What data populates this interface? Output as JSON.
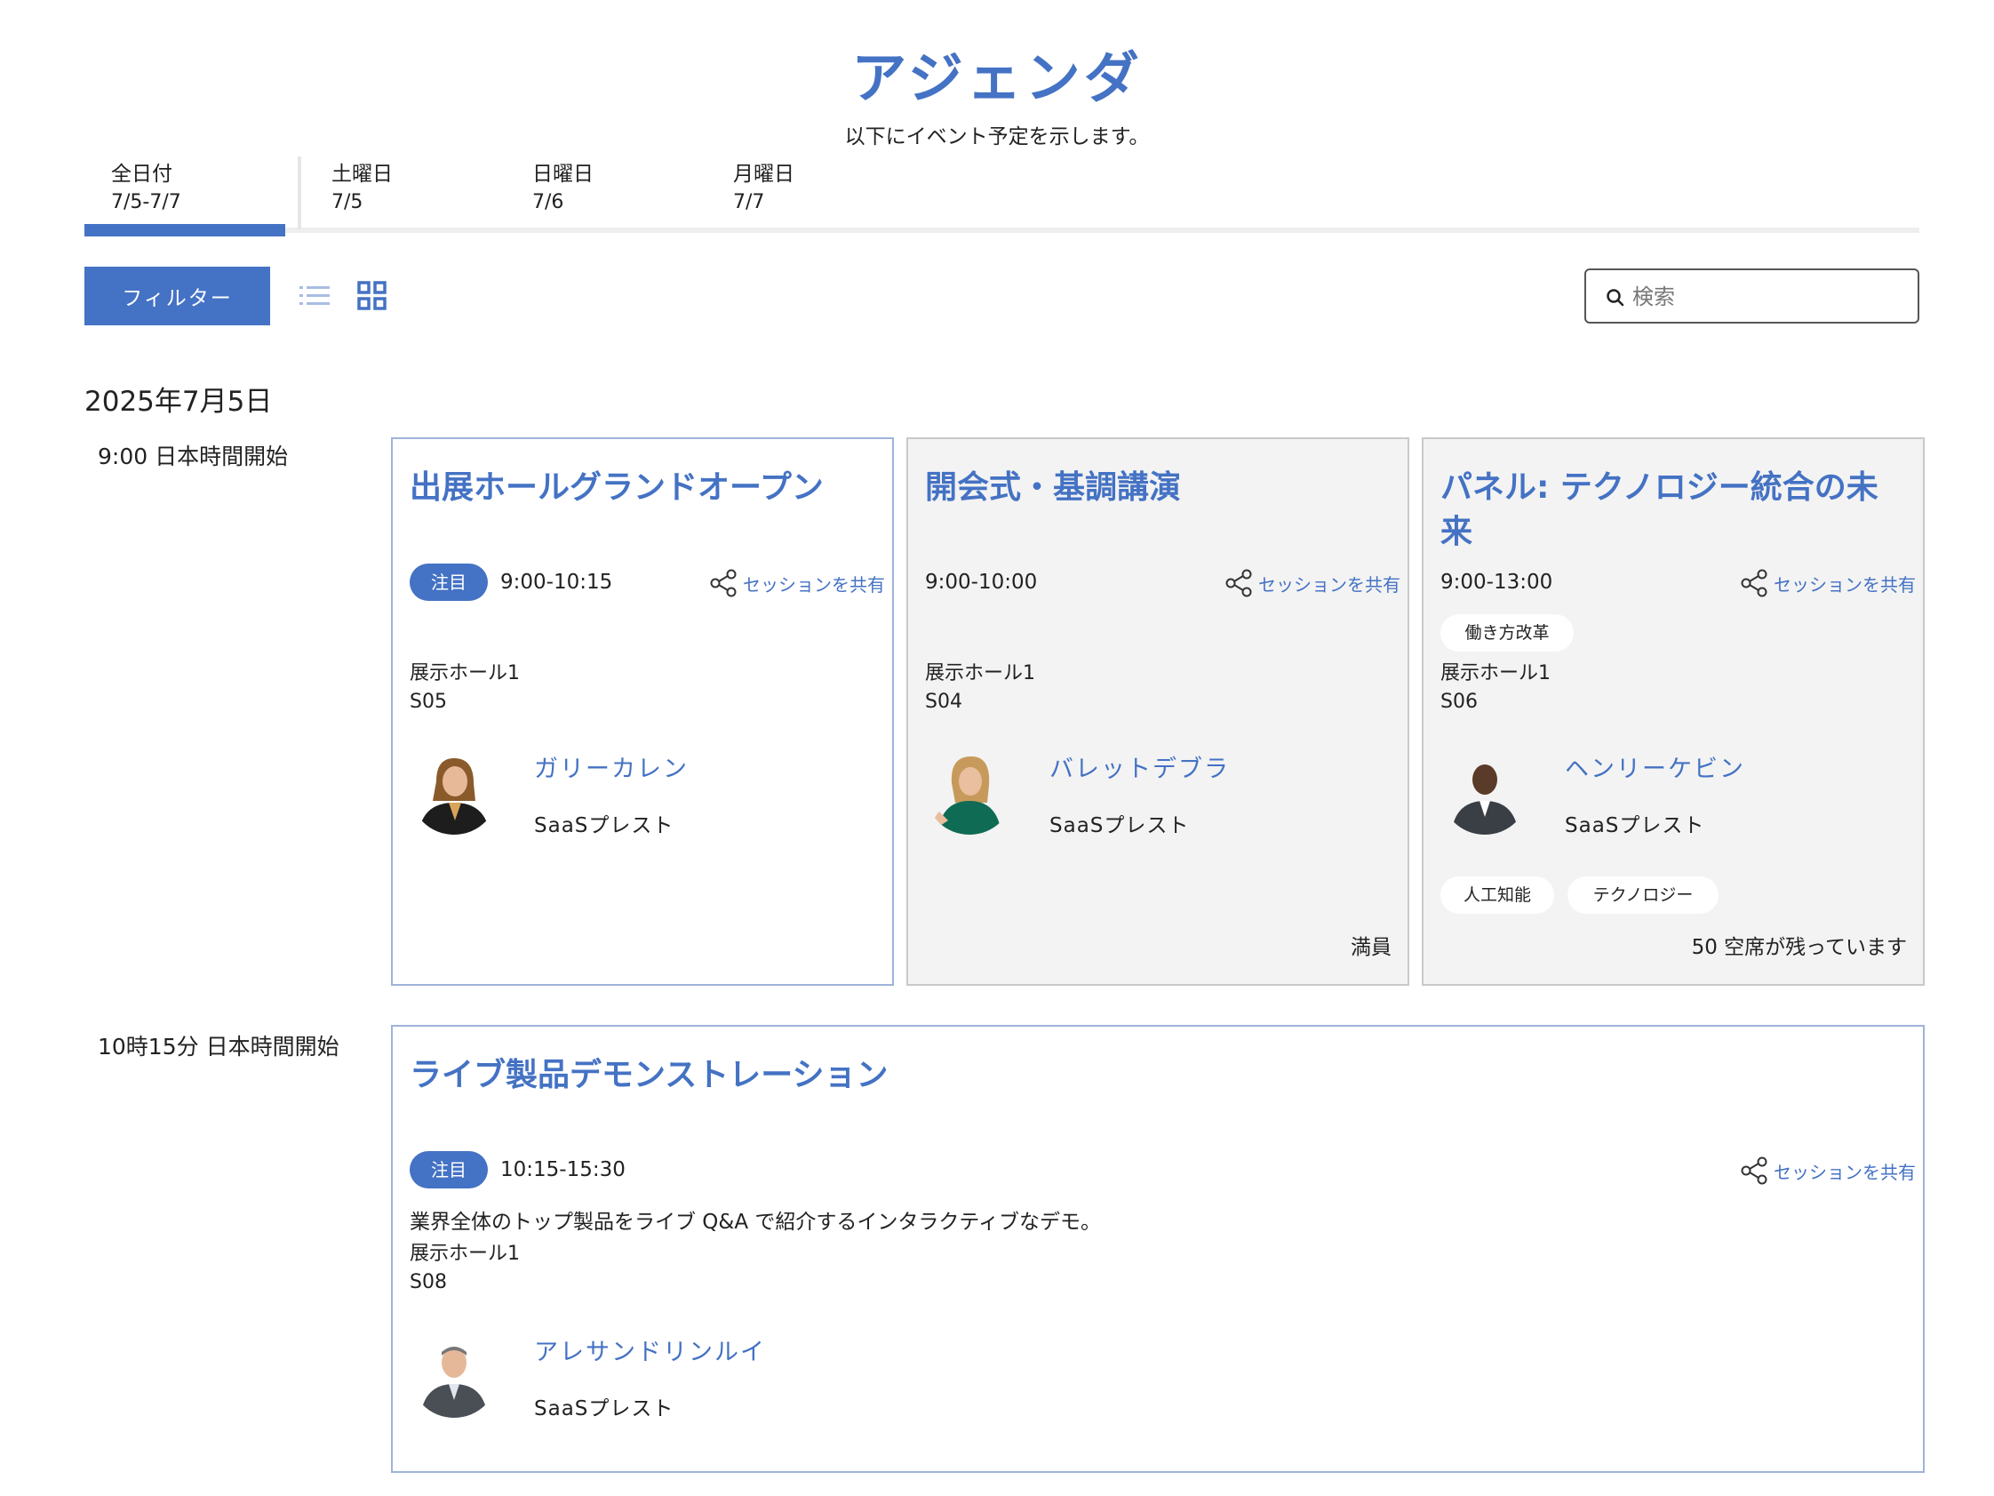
{
  "header": {
    "title": "アジェンダ",
    "subtitle": "以下にイベント予定を示します。"
  },
  "date_tabs": [
    {
      "day": "全日付",
      "date": "7/5-7/7",
      "selected": true
    },
    {
      "day": "土曜日",
      "date": "7/5",
      "selected": false
    },
    {
      "day": "日曜日",
      "date": "7/6",
      "selected": false
    },
    {
      "day": "月曜日",
      "date": "7/7",
      "selected": false
    }
  ],
  "toolbar": {
    "filter_label": "フィルター",
    "list_view_icon": "list-icon",
    "grid_view_icon": "grid-icon",
    "active_view": "grid",
    "search_placeholder": "検索",
    "search_value": ""
  },
  "schedule": {
    "day_heading": "2025年7月5日",
    "time_slots": [
      "9:00 日本時間開始",
      "10時15分 日本時間開始"
    ]
  },
  "sessions": [
    {
      "title": "出展ホールグランドオープン",
      "featured_badge": "注目",
      "time": "9:00-10:15",
      "share_label": "セッションを共有",
      "location": "展示ホール1",
      "code": "S05",
      "speaker": {
        "name": "ガリーカレン",
        "company": "SaaSプレスト"
      }
    },
    {
      "title": "開会式・基調講演",
      "time": "9:00-10:00",
      "share_label": "セッションを共有",
      "location": "展示ホール1",
      "code": "S04",
      "speaker": {
        "name": "バレットデブラ",
        "company": "SaaSプレスト"
      },
      "capacity": "満員"
    },
    {
      "title": "パネル: テクノロジー統合の未来",
      "time": "9:00-13:00",
      "share_label": "セッションを共有",
      "track_tag": "働き方改革",
      "location": "展示ホール1",
      "code": "S06",
      "speaker": {
        "name": "ヘンリーケビン",
        "company": "SaaSプレスト"
      },
      "tags": [
        "人工知能",
        "テクノロジー"
      ],
      "capacity": "50 空席が残っています"
    },
    {
      "title": "ライブ製品デモンストレーション",
      "featured_badge": "注目",
      "time": "10:15-15:30",
      "share_label": "セッションを共有",
      "description": "業界全体のトップ製品をライブ Q&A で紹介するインタラクティブなデモ。",
      "location": "展示ホール1",
      "code": "S08",
      "speaker": {
        "name": "アレサンドリンルイ",
        "company": "SaaSプレスト"
      }
    }
  ],
  "colors": {
    "accent": "#4472c4",
    "card_muted_bg": "#f3f3f3",
    "card_featured_border": "#9fb3d9"
  }
}
